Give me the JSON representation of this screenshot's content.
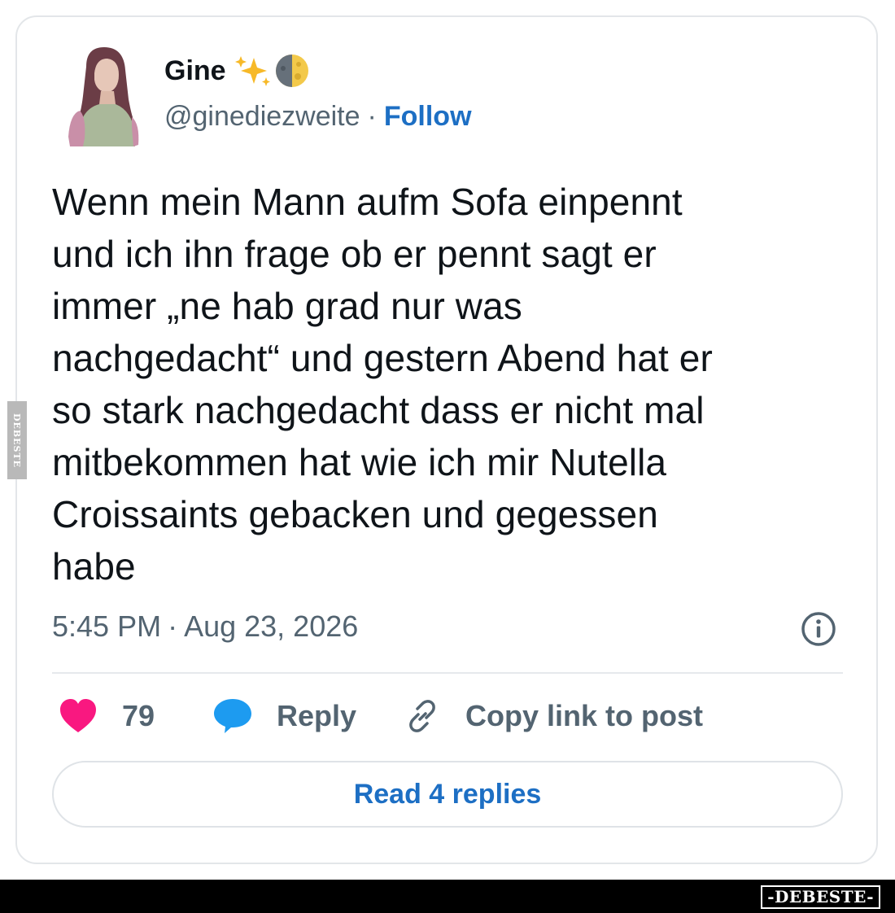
{
  "author": {
    "name": "Gine",
    "name_emoji_icons": [
      "sparkles-icon",
      "last-quarter-moon-icon"
    ],
    "handle": "@ginediezweite",
    "separator": "·",
    "follow_label": "Follow"
  },
  "tweet": {
    "lines": [
      "Wenn mein Mann aufm Sofa einpennt",
      "und ich ihn frage ob er pennt sagt er",
      "immer „ne hab grad nur was",
      "nachgedacht“ und gestern Abend hat er",
      "so stark nachgedacht dass er nicht mal",
      "mitbekommen hat wie ich mir Nutella",
      "Croissaints gebacken und gegessen",
      "habe"
    ],
    "time": "5:45 PM",
    "separator": "·",
    "date": "Aug 23, 2026"
  },
  "actions": {
    "like_count": "79",
    "reply_label": "Reply",
    "copy_label": "Copy link to post",
    "read_replies_label": "Read 4 replies"
  },
  "colors": {
    "heart": "#f91880",
    "reply_bubble": "#1d9bf0",
    "link_blue": "#1d6fc4",
    "muted_text": "#536471"
  },
  "watermark": {
    "side_text": "DEBESTE",
    "footer_logo": "-DEBESTE-"
  }
}
